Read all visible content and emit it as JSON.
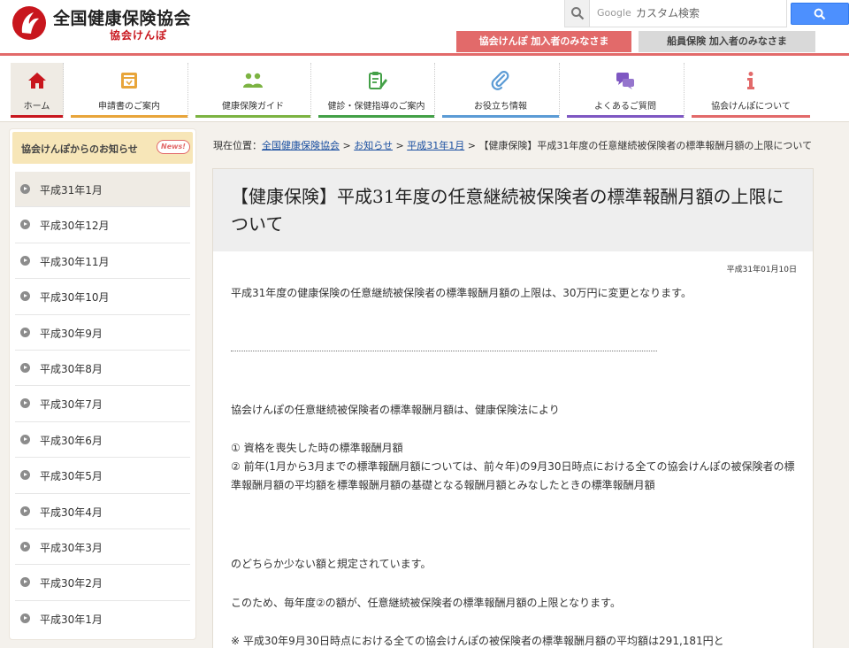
{
  "header": {
    "logo_title": "全国健康保険協会",
    "logo_sub": "協会けんぽ",
    "search_placeholder": "カスタム検索",
    "search_brand": "Google",
    "tab_member": "協会けんぽ 加入者のみなさま",
    "tab_ship": "船員保険 加入者のみなさま"
  },
  "nav": {
    "items": [
      {
        "label": "ホーム",
        "icon": "home-icon",
        "color": "#c8161d"
      },
      {
        "label": "申請書のご案内",
        "icon": "form-icon",
        "color": "#e8a53a"
      },
      {
        "label": "健康保険ガイド",
        "icon": "people-icon",
        "color": "#7cb342"
      },
      {
        "label": "健診・保健指導のご案内",
        "icon": "clipboard-icon",
        "color": "#43a047"
      },
      {
        "label": "お役立ち情報",
        "icon": "clip-icon",
        "color": "#5b9bd5"
      },
      {
        "label": "よくあるご質問",
        "icon": "chat-icon",
        "color": "#7e57c2"
      },
      {
        "label": "協会けんぽについて",
        "icon": "info-icon",
        "color": "#e26a6a"
      }
    ]
  },
  "sidebar": {
    "title": "協会けんぽからのお知らせ",
    "badge": "News!",
    "items": [
      "平成31年1月",
      "平成30年12月",
      "平成30年11月",
      "平成30年10月",
      "平成30年9月",
      "平成30年8月",
      "平成30年7月",
      "平成30年6月",
      "平成30年5月",
      "平成30年4月",
      "平成30年3月",
      "平成30年2月",
      "平成30年1月"
    ]
  },
  "breadcrumb": {
    "prefix": "現在位置：",
    "link1": "全国健康保険協会",
    "link2": "お知らせ",
    "link3": "平成31年1月",
    "sep": " > ",
    "current": "【健康保険】平成31年度の任意継続被保険者の標準報酬月額の上限について"
  },
  "article": {
    "title": "【健康保険】平成31年度の任意継続被保険者の標準報酬月額の上限について",
    "date": "平成31年01月10日",
    "p1": "平成31年度の健康保険の任意継続被保険者の標準報酬月額の上限は、30万円に変更となります。",
    "p2": "協会けんぽの任意継続被保険者の標準報酬月額は、健康保険法により",
    "p3": "① 資格を喪失した時の標準報酬月額",
    "p4": "② 前年(1月から3月までの標準報酬月額については、前々年)の9月30日時点における全ての協会けんぽの被保険者の標準報酬月額の平均額を標準報酬月額の基礎となる報酬月額とみなしたときの標準報酬月額",
    "p5": "のどちらか少ない額と規定されています。",
    "p6": "このため、毎年度②の額が、任意継続被保険者の標準報酬月額の上限となります。",
    "p7": "※ 平成30年9月30日時点における全ての協会けんぽの被保険者の標準報酬月額の平均額は291,181円と"
  }
}
